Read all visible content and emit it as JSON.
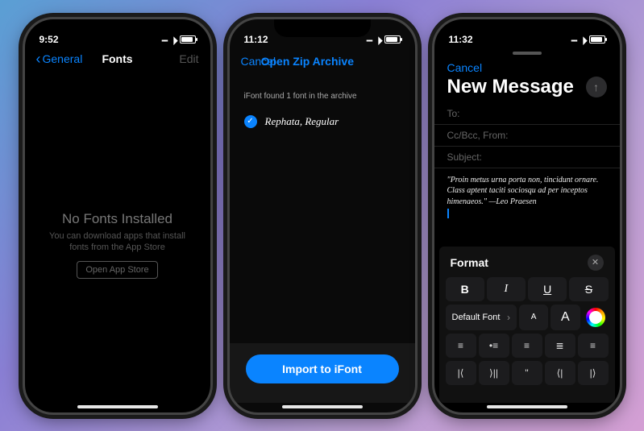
{
  "phone1": {
    "time": "9:52",
    "back_label": "General",
    "title": "Fonts",
    "edit": "Edit",
    "empty_title": "No Fonts Installed",
    "empty_sub": "You can download apps that install fonts from the App Store",
    "appstore_button": "Open App Store"
  },
  "phone2": {
    "time": "11:12",
    "cancel": "Cancel",
    "title": "Open Zip Archive",
    "info": "iFont found 1 font in the archive",
    "font_item": "Rephata, Regular",
    "import_button": "Import to iFont"
  },
  "phone3": {
    "time": "11:32",
    "cancel": "Cancel",
    "title": "New Message",
    "fields": {
      "to": "To:",
      "ccbcc": "Cc/Bcc, From:",
      "subject": "Subject:"
    },
    "body": "\"Proin metus urna porta non, tincidunt ornare. Class aptent taciti sociosqu ad per inceptos himenaeos.\"  —Leo Praesen",
    "format": {
      "title": "Format",
      "bold": "B",
      "italic": "I",
      "underline": "U",
      "strike": "S",
      "font_select": "Default Font",
      "size_small": "A",
      "size_large": "A"
    }
  }
}
